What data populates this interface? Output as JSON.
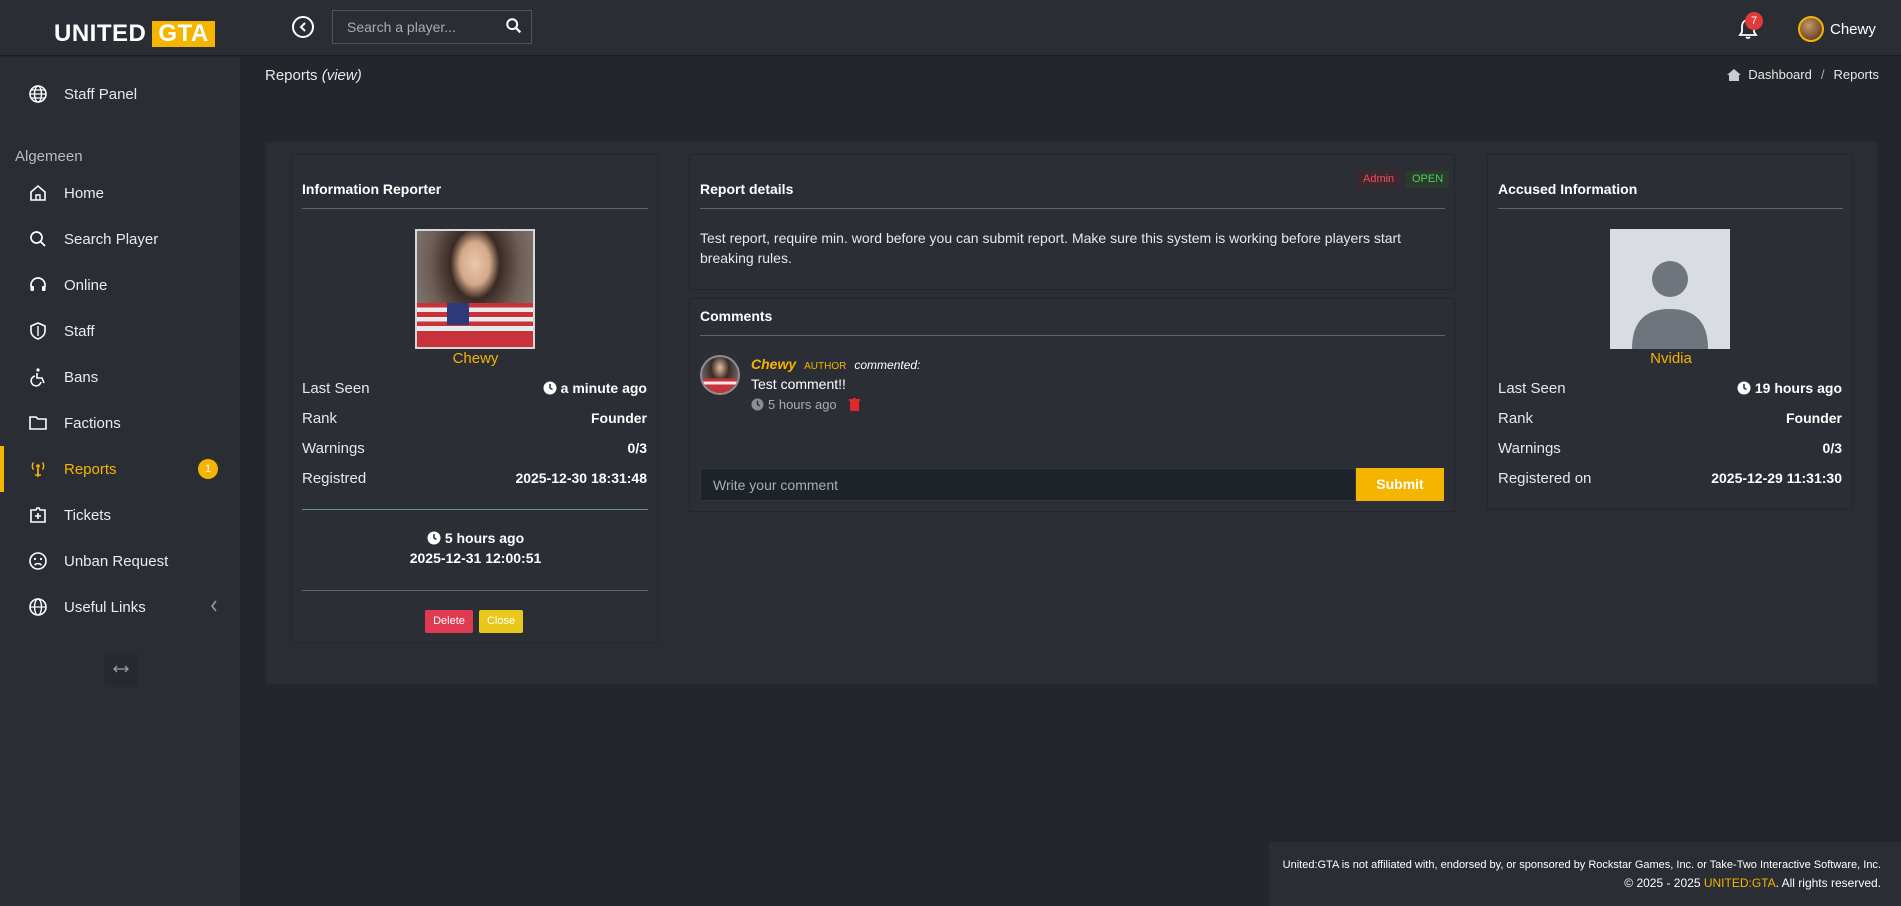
{
  "app": {
    "logo_left": "UNITED",
    "logo_right": "GTA",
    "search_placeholder": "Search a player...",
    "notification_count": "7",
    "user_name": "Chewy"
  },
  "sidebar": {
    "staff_panel": "Staff Panel",
    "section": "Algemeen",
    "items": [
      {
        "label": "Home",
        "icon": "home-icon"
      },
      {
        "label": "Search Player",
        "icon": "search-icon"
      },
      {
        "label": "Online",
        "icon": "headset-icon"
      },
      {
        "label": "Staff",
        "icon": "shield-icon"
      },
      {
        "label": "Bans",
        "icon": "wheelchair-icon"
      },
      {
        "label": "Factions",
        "icon": "folder-icon"
      },
      {
        "label": "Reports",
        "icon": "antenna-icon",
        "badge": "1",
        "active": true
      },
      {
        "label": "Tickets",
        "icon": "ticket-icon"
      },
      {
        "label": "Unban Request",
        "icon": "sad-face-icon"
      },
      {
        "label": "Useful Links",
        "icon": "globe-icon"
      }
    ]
  },
  "page": {
    "title": "Reports",
    "title_suffix": "(view)",
    "breadcrumb": [
      "Dashboard",
      "Reports"
    ]
  },
  "reporter": {
    "title": "Information Reporter",
    "name": "Chewy",
    "rows": [
      {
        "label": "Last Seen",
        "value": "a minute ago"
      },
      {
        "label": "Rank",
        "value": "Founder"
      },
      {
        "label": "Warnings",
        "value": "0/3"
      },
      {
        "label": "Registred",
        "value": "2025-12-30 18:31:48"
      }
    ],
    "created_ago": "5 hours ago",
    "created_at": "2025-12-31 12:00:51",
    "delete_label": "Delete",
    "close_label": "Close"
  },
  "report": {
    "title": "Report details",
    "badge_admin": "Admin",
    "badge_open": "OPEN",
    "text": "Test report, require min.  word before you can submit report. Make sure this system is working before players start breaking rules."
  },
  "comments": {
    "title": "Comments",
    "items": [
      {
        "author": "Chewy",
        "role": "AUTHOR",
        "action": "commented:",
        "text": "Test comment!!",
        "time": "5 hours ago"
      }
    ],
    "input_placeholder": "Write your comment",
    "submit_label": "Submit"
  },
  "accused": {
    "title": "Accused Information",
    "name": "Nvidia",
    "rows": [
      {
        "label": "Last Seen",
        "value": "19 hours ago"
      },
      {
        "label": "Rank",
        "value": "Founder"
      },
      {
        "label": "Warnings",
        "value": "0/3"
      },
      {
        "label": "Registered on",
        "value": "2025-12-29 11:31:30"
      }
    ]
  },
  "footer": {
    "line1": "United:GTA is not affiliated with, endorsed by, or sponsored by Rockstar Games, Inc. or Take-Two Interactive Software, Inc.",
    "line2_prefix": "© 2025 - 2025 ",
    "line2_brand": "UNITED:GTA",
    "line2_suffix": ". All rights reserved."
  },
  "colors": {
    "accent": "#f5b400",
    "danger": "#e03a52",
    "warning": "#e8c81a",
    "bg": "#23262b",
    "panel": "#2a2d33"
  }
}
